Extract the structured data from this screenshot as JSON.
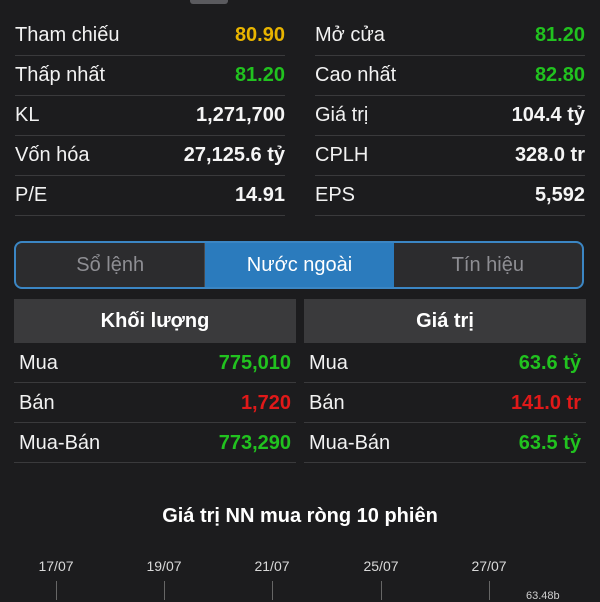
{
  "stats": [
    {
      "label": "Tham chiếu",
      "value": "80.90",
      "color": "yellow"
    },
    {
      "label": "Mở cửa",
      "value": "81.20",
      "color": "green"
    },
    {
      "label": "Thấp nhất",
      "value": "81.20",
      "color": "green"
    },
    {
      "label": "Cao nhất",
      "value": "82.80",
      "color": "green"
    },
    {
      "label": "KL",
      "value": "1,271,700",
      "color": "white"
    },
    {
      "label": "Giá trị",
      "value": "104.4 tỷ",
      "color": "white"
    },
    {
      "label": "Vốn hóa",
      "value": "27,125.6 tỷ",
      "color": "white"
    },
    {
      "label": "CPLH",
      "value": "328.0 tr",
      "color": "white"
    },
    {
      "label": "P/E",
      "value": "14.91",
      "color": "white"
    },
    {
      "label": "EPS",
      "value": "5,592",
      "color": "white"
    }
  ],
  "tabs": [
    "Sổ lệnh",
    "Nước ngoài",
    "Tín hiệu"
  ],
  "active_tab": "Nước ngoài",
  "volume": {
    "header": "Khối lượng",
    "rows": [
      {
        "label": "Mua",
        "value": "775,010",
        "color": "green"
      },
      {
        "label": "Bán",
        "value": "1,720",
        "color": "red"
      },
      {
        "label": "Mua-Bán",
        "value": "773,290",
        "color": "green"
      }
    ]
  },
  "value": {
    "header": "Giá trị",
    "rows": [
      {
        "label": "Mua",
        "value": "63.6 tỷ",
        "color": "green"
      },
      {
        "label": "Bán",
        "value": "141.0 tr",
        "color": "red"
      },
      {
        "label": "Mua-Bán",
        "value": "63.5 tỷ",
        "color": "green"
      }
    ]
  },
  "chart": {
    "title": "Giá trị NN mua ròng 10 phiên",
    "x_labels": [
      "17/07",
      "19/07",
      "21/07",
      "25/07",
      "27/07"
    ],
    "last_value_label": "63.48b"
  }
}
